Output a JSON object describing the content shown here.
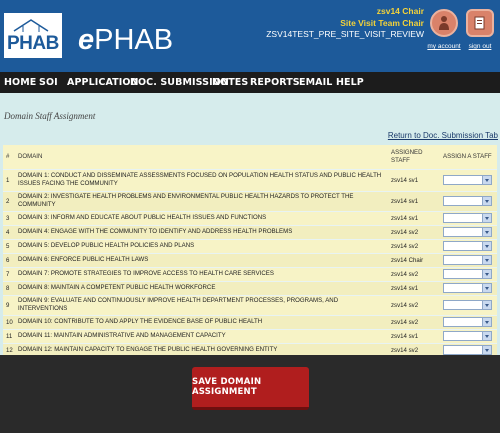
{
  "header": {
    "logo_text": "PHAB",
    "brand_prefix": "e",
    "brand_text": "PHAB",
    "user_name": "zsv14 Chair",
    "user_role": "Site Visit Team Chair",
    "context_code": "ZSV14TEST_PRE_SITE_VISIT_REVIEW",
    "my_account_label": "my account",
    "sign_out_label": "sign out"
  },
  "nav": {
    "items": [
      "HOME",
      "SOI",
      "APPLICATION",
      "DOC. SUBMISSION",
      "NOTES",
      "REPORTS",
      "EMAIL",
      "HELP"
    ]
  },
  "page": {
    "title": "Domain Staff Assignment",
    "return_link": "Return to Doc. Submission Tab"
  },
  "table": {
    "headers": {
      "num": "#",
      "domain": "DOMAIN",
      "assigned": "ASSIGNED STAFF",
      "assign": "ASSIGN A STAFF"
    },
    "rows": [
      {
        "num": "1",
        "domain": "DOMAIN 1: CONDUCT AND DISSEMINATE ASSESSMENTS FOCUSED ON POPULATION HEALTH STATUS AND PUBLIC HEALTH ISSUES FACING THE COMMUNITY",
        "staff": "zsv14 sv1"
      },
      {
        "num": "2",
        "domain": "DOMAIN 2: INVESTIGATE HEALTH PROBLEMS AND ENVIRONMENTAL PUBLIC HEALTH HAZARDS TO PROTECT THE COMMUNITY",
        "staff": "zsv14 sv1"
      },
      {
        "num": "3",
        "domain": "DOMAIN 3: INFORM AND EDUCATE ABOUT PUBLIC HEALTH ISSUES AND FUNCTIONS",
        "staff": "zsv14 sv1"
      },
      {
        "num": "4",
        "domain": "DOMAIN 4: ENGAGE WITH THE COMMUNITY TO IDENTIFY AND ADDRESS HEALTH PROBLEMS",
        "staff": "zsv14 sv2"
      },
      {
        "num": "5",
        "domain": "DOMAIN 5: DEVELOP PUBLIC HEALTH POLICIES AND PLANS",
        "staff": "zsv14 sv2"
      },
      {
        "num": "6",
        "domain": "DOMAIN 6: ENFORCE PUBLIC HEALTH LAWS",
        "staff": "zsv14 Chair"
      },
      {
        "num": "7",
        "domain": "DOMAIN 7: PROMOTE STRATEGIES TO IMPROVE ACCESS TO HEALTH CARE SERVICES",
        "staff": "zsv14 sv2"
      },
      {
        "num": "8",
        "domain": "DOMAIN 8: MAINTAIN A COMPETENT PUBLIC HEALTH WORKFORCE",
        "staff": "zsv14 sv1"
      },
      {
        "num": "9",
        "domain": "DOMAIN 9: EVALUATE AND CONTINUOUSLY IMPROVE HEALTH DEPARTMENT PROCESSES, PROGRAMS, AND INTERVENTIONS",
        "staff": "zsv14 sv2"
      },
      {
        "num": "10",
        "domain": "DOMAIN 10: CONTRIBUTE TO AND APPLY THE EVIDENCE BASE OF PUBLIC HEALTH",
        "staff": "zsv14 sv2"
      },
      {
        "num": "11",
        "domain": "DOMAIN 11: MAINTAIN ADMINISTRATIVE AND MANAGEMENT CAPACITY",
        "staff": "zsv14 sv1"
      },
      {
        "num": "12",
        "domain": "DOMAIN 12: MAINTAIN CAPACITY TO ENGAGE THE PUBLIC HEALTH GOVERNING ENTITY",
        "staff": "zsv14 sv2"
      }
    ]
  },
  "footer": {
    "save_label": "SAVE DOMAIN ASSIGNMENT"
  },
  "colors": {
    "header_bg": "#1d5a9a",
    "nav_bg": "#1c1c1c",
    "accent_yellow": "#f3d23a",
    "save_button": "#b01e1e"
  },
  "icons": {
    "my_account": "user-icon",
    "sign_out": "sign-out-icon"
  }
}
